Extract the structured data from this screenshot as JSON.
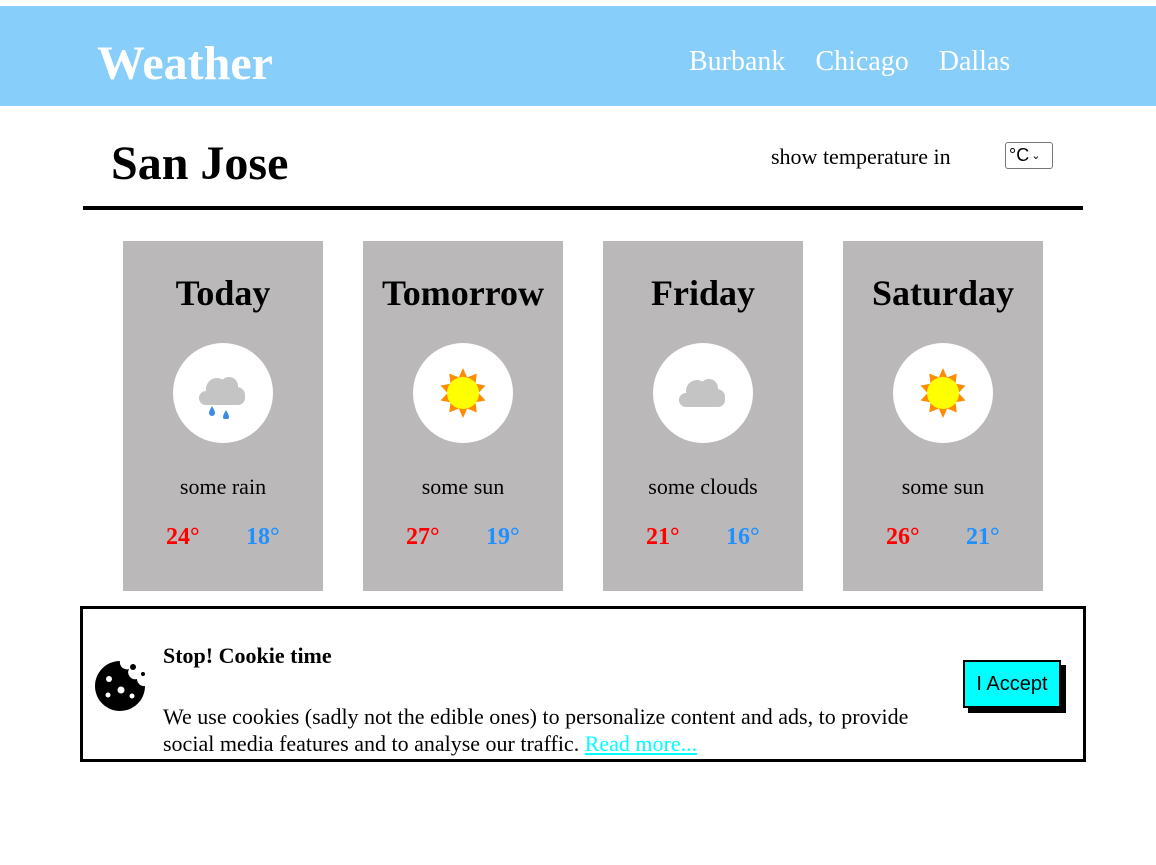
{
  "header": {
    "brand": "Weather",
    "nav": [
      "Burbank",
      "Chicago",
      "Dallas"
    ]
  },
  "location": {
    "city": "San Jose",
    "unit_label": "show temperature in",
    "unit_selected": "°C"
  },
  "forecast": [
    {
      "day": "Today",
      "icon": "rain-cloud-icon",
      "desc": "some rain",
      "high": "24°",
      "low": "18°"
    },
    {
      "day": "Tomorrow",
      "icon": "sun-icon",
      "desc": "some sun",
      "high": "27°",
      "low": "19°"
    },
    {
      "day": "Friday",
      "icon": "cloud-icon",
      "desc": "some clouds",
      "high": "21°",
      "low": "16°"
    },
    {
      "day": "Saturday",
      "icon": "sun-icon",
      "desc": "some sun",
      "high": "26°",
      "low": "21°"
    }
  ],
  "cookie": {
    "title": "Stop! Cookie time",
    "text": "We use cookies (sadly not the edible ones) to personalize content and ads, to provide social media features and to analyse our traffic.",
    "link": "Read more...",
    "accept": "I Accept"
  },
  "colors": {
    "header_bg": "#87cefa",
    "card_bg": "#bab8b9",
    "high_temp": "#ff0000",
    "low_temp": "#1e90ff",
    "accent": "#00ffff"
  }
}
